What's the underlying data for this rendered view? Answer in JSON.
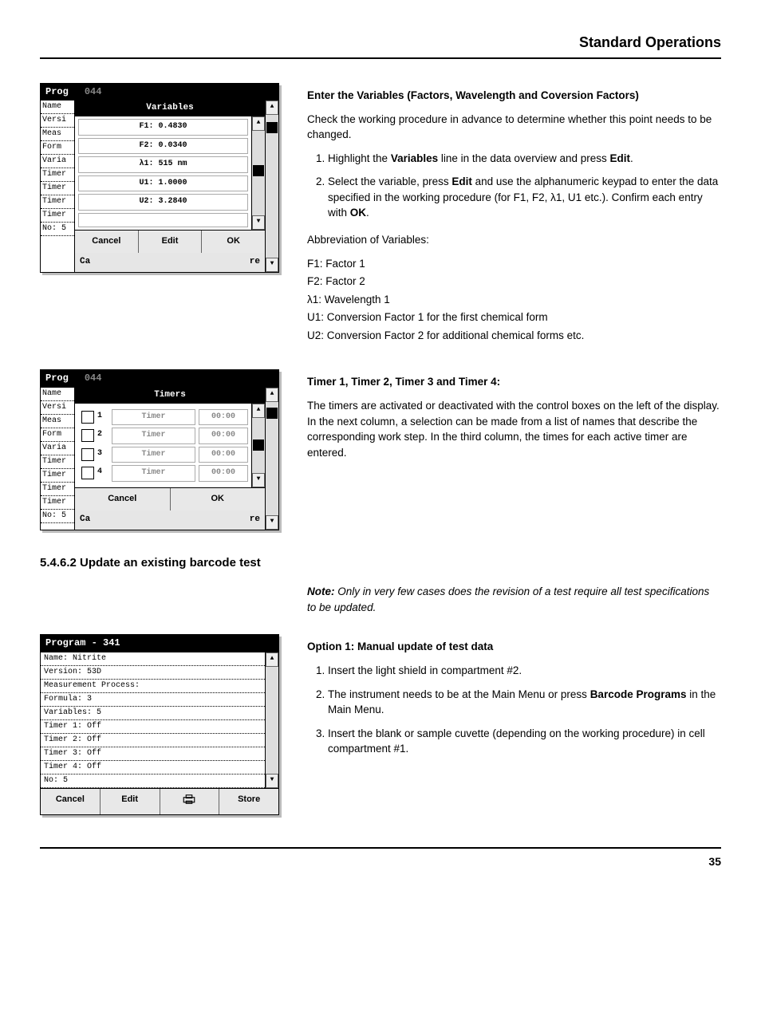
{
  "header": {
    "title": "Standard Operations"
  },
  "page_number": "35",
  "screenshot1": {
    "program_label": "Prog",
    "program_suffix": "044",
    "panel_title": "Variables",
    "side_labels": [
      "Name",
      "Versi",
      "Meas",
      "Form",
      "Varia",
      "Timer",
      "Timer",
      "Timer",
      "Timer",
      "No: 5"
    ],
    "items": [
      "F1: 0.4830",
      "F2: 0.0340",
      "λ1: 515 nm",
      "U1: 1.0000",
      "U2: 3.2840"
    ],
    "buttons": {
      "cancel": "Cancel",
      "edit": "Edit",
      "ok": "OK"
    },
    "footer_ca": "Ca",
    "footer_re": "re"
  },
  "section1": {
    "title": "Enter the Variables (Factors, Wavelength and Coversion Factors)",
    "intro": "Check the working procedure in advance to determine whether this point needs to be changed.",
    "step1_pre": "Highlight the ",
    "step1_bold": "Variables",
    "step1_mid": " line in the data overview and press ",
    "step1_bold2": "Edit",
    "step1_end": ".",
    "step2_pre": "Select the variable, press ",
    "step2_bold": "Edit",
    "step2_mid": " and use the alphanumeric keypad to enter the data specified in the working procedure (for F1, F2, λ1, U1 etc.). Confirm each entry with ",
    "step2_bold2": "OK",
    "step2_end": ".",
    "abbr_title": "Abbreviation of Variables:",
    "abbr": [
      "F1: Factor 1",
      "F2: Factor 2",
      "λ1: Wavelength 1",
      "U1: Conversion Factor 1 for the first chemical form",
      "U2: Conversion Factor 2 for additional chemical forms etc."
    ]
  },
  "screenshot2": {
    "program_label": "Prog",
    "program_suffix": "044",
    "panel_title": "Timers",
    "side_labels": [
      "Name",
      "Versi",
      "Meas",
      "Form",
      "Varia",
      "Timer",
      "Timer",
      "Timer",
      "Timer",
      "No: 5"
    ],
    "rows": [
      {
        "n": "1",
        "name": "Timer",
        "time": "00:00"
      },
      {
        "n": "2",
        "name": "Timer",
        "time": "00:00"
      },
      {
        "n": "3",
        "name": "Timer",
        "time": "00:00"
      },
      {
        "n": "4",
        "name": "Timer",
        "time": "00:00"
      }
    ],
    "buttons": {
      "cancel": "Cancel",
      "ok": "OK"
    },
    "footer_ca": "Ca",
    "footer_re": "re"
  },
  "section2": {
    "title": "Timer 1, Timer 2, Timer 3 and Timer 4:",
    "body": "The timers are activated or deactivated with the control boxes on the left of the display. In the next column, a selection can be made from a list of names that describe the corresponding work step. In the third column, the times for each active timer are entered."
  },
  "heading_update": "5.4.6.2  Update an existing barcode test",
  "note": "Note: Only in very few cases does the revision of a test require all test specifications to be updated.",
  "screenshot3": {
    "title": "Program - 341",
    "rows": [
      "Name: Nitrite",
      "Version: 53D",
      "Measurement Process:",
      "Formula: 3",
      "Variables: 5",
      "Timer 1: Off",
      "Timer 2: Off",
      "Timer 3: Off",
      "Timer 4: Off",
      "No: 5"
    ],
    "buttons": {
      "cancel": "Cancel",
      "edit": "Edit",
      "store": "Store"
    }
  },
  "section3": {
    "title": "Option 1: Manual update of test data",
    "step1": "Insert the light shield in compartment #2.",
    "step2_pre": "The instrument needs to be at the Main Menu or press ",
    "step2_bold": "Barcode Programs",
    "step2_end": " in the Main Menu.",
    "step3": "Insert the blank or sample cuvette (depending on the working procedure) in cell compartment #1."
  }
}
